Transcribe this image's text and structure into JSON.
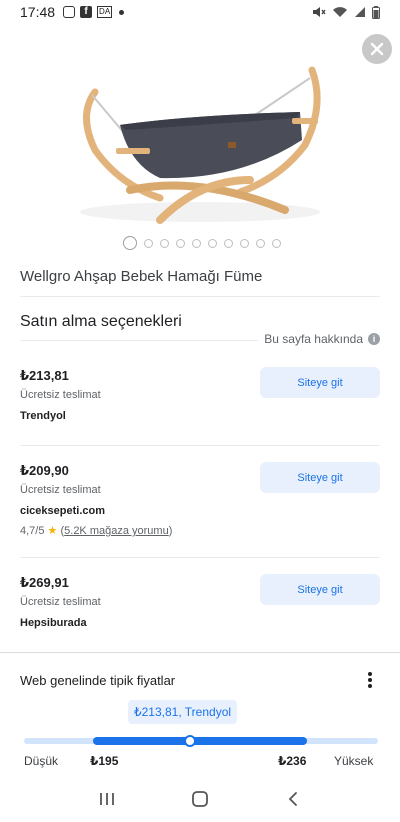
{
  "status_bar": {
    "time": "17:48",
    "notification_badge": "DA"
  },
  "product": {
    "title": "Wellgro Ahşap Bebek Hamağı Füme",
    "image_count": 10,
    "active_image": 1
  },
  "purchase": {
    "section_title": "Satın alma seçenekleri",
    "about_page": "Bu sayfa hakkında",
    "offers": [
      {
        "price": "₺213,81",
        "shipping": "Ücretsiz teslimat",
        "store": "Trendyol",
        "button": "Siteye git"
      },
      {
        "price": "₺209,90",
        "shipping": "Ücretsiz teslimat",
        "store": "ciceksepeti.com",
        "button": "Siteye git",
        "rating": "4,7/5",
        "reviews": "5.2K mağaza yorumu"
      },
      {
        "price": "₺269,91",
        "shipping": "Ücretsiz teslimat",
        "store": "Hepsiburada",
        "button": "Siteye git"
      }
    ]
  },
  "typical_prices": {
    "title": "Web genelinde tipik fiyatlar",
    "tooltip": "₺213,81, Trendyol",
    "low_label": "Düşük",
    "low_value": "₺195",
    "high_value": "₺236",
    "high_label": "Yüksek"
  },
  "colors": {
    "accent": "#1a73e8",
    "button_bg": "#e8f0fe",
    "hammock_fabric": "#4a4d58",
    "wood": "#e2b47c",
    "star": "#f4b400"
  }
}
